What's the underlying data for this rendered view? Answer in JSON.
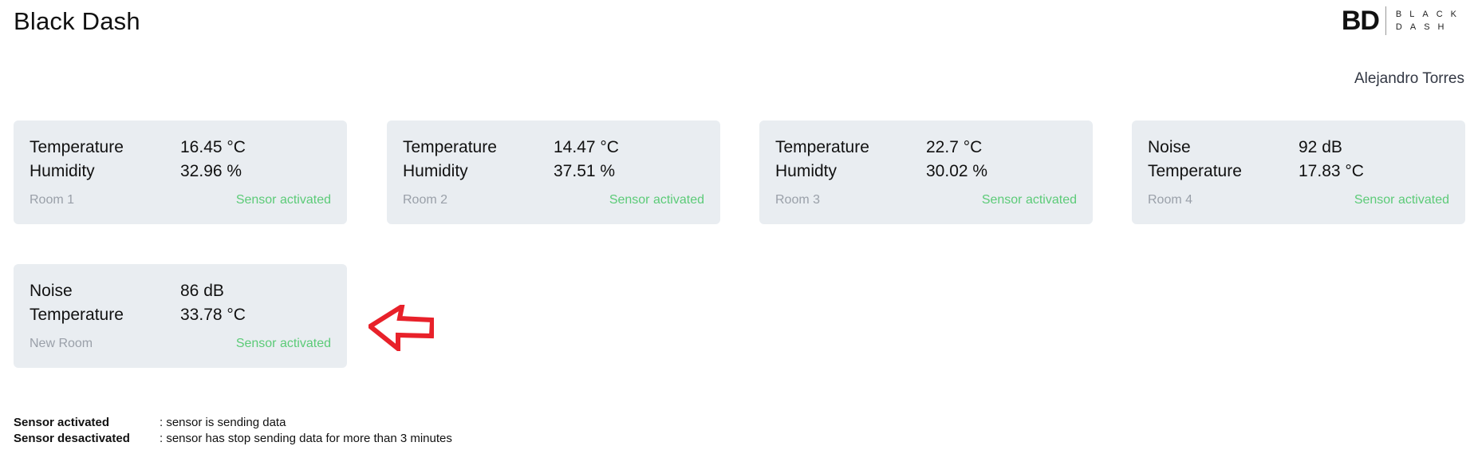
{
  "header": {
    "title": "Black Dash",
    "logo": {
      "mark": "BD",
      "line1": "BLACK",
      "line2": "DASH"
    },
    "user_name": "Alejandro Torres"
  },
  "cards": [
    {
      "rows": [
        {
          "label": "Temperature",
          "value": "16.45 °C"
        },
        {
          "label": "Humidity",
          "value": "32.96 %"
        }
      ],
      "room": "Room 1",
      "status": "Sensor activated"
    },
    {
      "rows": [
        {
          "label": "Temperature",
          "value": "14.47 °C"
        },
        {
          "label": "Humidity",
          "value": "37.51 %"
        }
      ],
      "room": "Room 2",
      "status": "Sensor activated"
    },
    {
      "rows": [
        {
          "label": "Temperature",
          "value": "22.7 °C"
        },
        {
          "label": "Humidty",
          "value": "30.02 %"
        }
      ],
      "room": "Room 3",
      "status": "Sensor activated"
    },
    {
      "rows": [
        {
          "label": "Noise",
          "value": "92 dB"
        },
        {
          "label": "Temperature",
          "value": "17.83 °C"
        }
      ],
      "room": "Room 4",
      "status": "Sensor activated"
    },
    {
      "rows": [
        {
          "label": "Noise",
          "value": "86 dB"
        },
        {
          "label": "Temperature",
          "value": "33.78 °C"
        }
      ],
      "room": "New Room",
      "status": "Sensor activated"
    }
  ],
  "legend": [
    {
      "term": "Sensor activated",
      "desc": ": sensor is sending data"
    },
    {
      "term": "Sensor desactivated",
      "desc": ": sensor has stop sending data for more than 3 minutes"
    }
  ],
  "colors": {
    "card_bg": "#e9edf1",
    "status_active": "#5ccb78",
    "room_label": "#9aa0a9",
    "arrow": "#e8212a"
  },
  "icons": {
    "pointer": "left-arrow-icon"
  }
}
